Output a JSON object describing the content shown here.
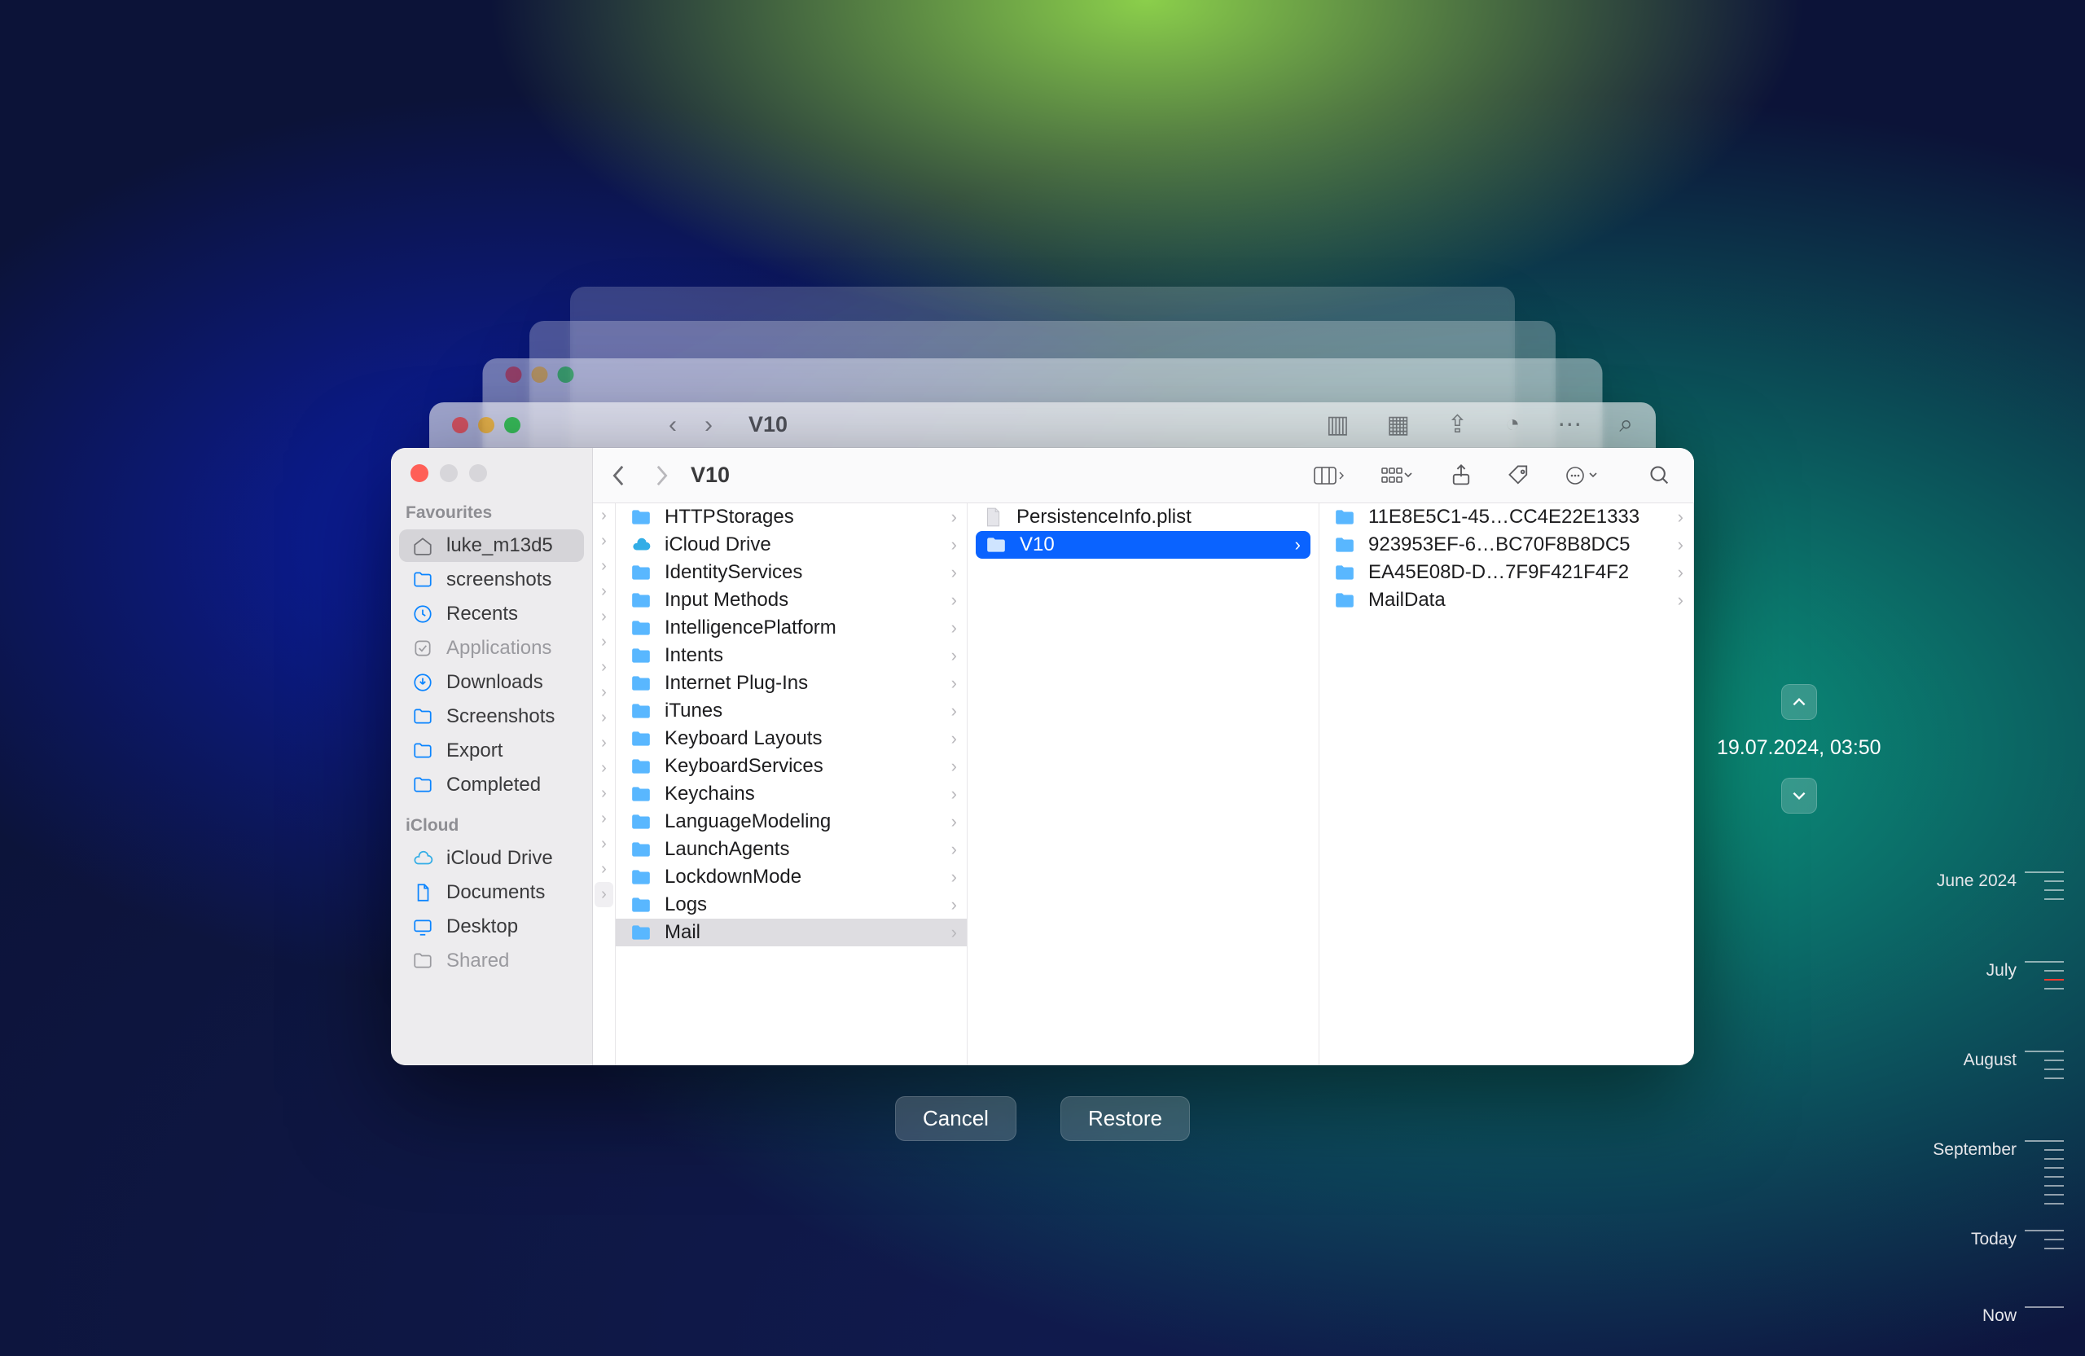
{
  "window": {
    "title": "V10"
  },
  "ghost": {
    "title": "V10"
  },
  "sidebar": {
    "sections": [
      {
        "label": "Favourites",
        "items": [
          {
            "icon": "home",
            "label": "luke_m13d5",
            "selected": true
          },
          {
            "icon": "folder",
            "label": "screenshots"
          },
          {
            "icon": "clock",
            "label": "Recents"
          },
          {
            "icon": "app",
            "label": "Applications",
            "muted": true
          },
          {
            "icon": "download",
            "label": "Downloads"
          },
          {
            "icon": "folder",
            "label": "Screenshots"
          },
          {
            "icon": "folder",
            "label": "Export"
          },
          {
            "icon": "folder",
            "label": "Completed"
          }
        ]
      },
      {
        "label": "iCloud",
        "items": [
          {
            "icon": "cloud",
            "label": "iCloud Drive"
          },
          {
            "icon": "doc",
            "label": "Documents"
          },
          {
            "icon": "desktop",
            "label": "Desktop"
          },
          {
            "icon": "shared",
            "label": "Shared",
            "muted": true
          }
        ]
      }
    ]
  },
  "columns": {
    "col2": [
      {
        "label": "HTTPStorages",
        "type": "folder"
      },
      {
        "label": "iCloud Drive",
        "type": "cloud"
      },
      {
        "label": "IdentityServices",
        "type": "folder"
      },
      {
        "label": "Input Methods",
        "type": "folder"
      },
      {
        "label": "IntelligencePlatform",
        "type": "folder"
      },
      {
        "label": "Intents",
        "type": "folder"
      },
      {
        "label": "Internet Plug-Ins",
        "type": "folder"
      },
      {
        "label": "iTunes",
        "type": "folder"
      },
      {
        "label": "Keyboard Layouts",
        "type": "folder"
      },
      {
        "label": "KeyboardServices",
        "type": "folder"
      },
      {
        "label": "Keychains",
        "type": "folder"
      },
      {
        "label": "LanguageModeling",
        "type": "folder"
      },
      {
        "label": "LaunchAgents",
        "type": "folder"
      },
      {
        "label": "LockdownMode",
        "type": "folder"
      },
      {
        "label": "Logs",
        "type": "folder"
      },
      {
        "label": "Mail",
        "type": "folder",
        "selected": true
      }
    ],
    "col3": [
      {
        "label": "PersistenceInfo.plist",
        "type": "file"
      },
      {
        "label": "V10",
        "type": "folder",
        "selected": true
      }
    ],
    "col4": [
      {
        "label": "11E8E5C1-45…CC4E22E1333",
        "type": "folder"
      },
      {
        "label": "923953EF-6…BC70F8B8DC5",
        "type": "folder"
      },
      {
        "label": "EA45E08D-D…7F9F421F4F2",
        "type": "folder"
      },
      {
        "label": "MailData",
        "type": "folder"
      }
    ]
  },
  "buttons": {
    "cancel": "Cancel",
    "restore": "Restore"
  },
  "tm": {
    "date": "19.07.2024, 03:50"
  },
  "timeline": [
    {
      "label": "June 2024"
    },
    {
      "label": "July"
    },
    {
      "label": "August"
    },
    {
      "label": "September"
    },
    {
      "label": "Today"
    },
    {
      "label": "Now"
    }
  ]
}
